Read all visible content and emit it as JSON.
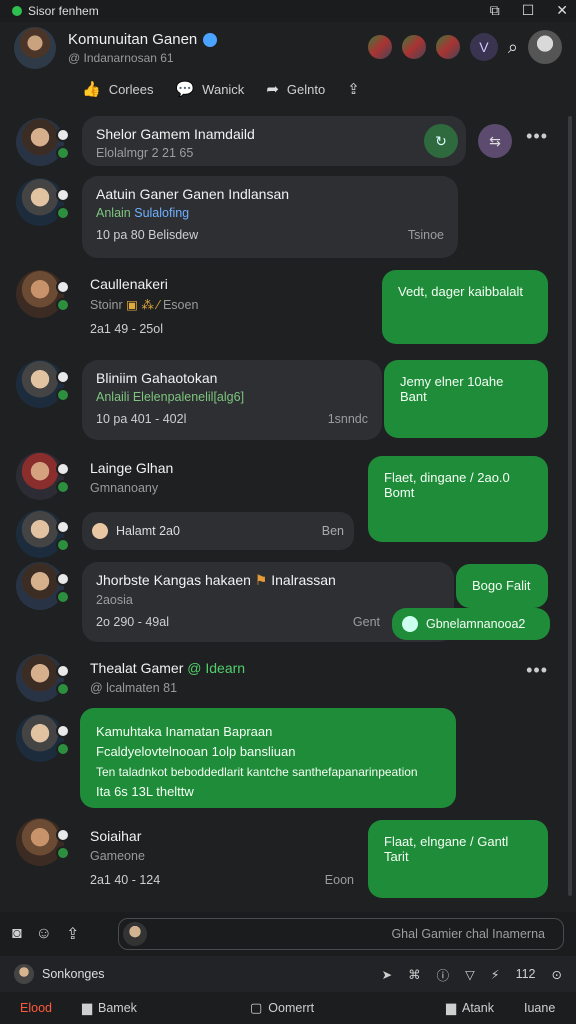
{
  "status": {
    "left_text": "Sisor fenhem",
    "win_icons": [
      "tabs-icon",
      "maximize-icon",
      "close-icon"
    ]
  },
  "header": {
    "title": "Komunuitan Ganen",
    "subtitle": "@ Indanarnosan 61",
    "v_badge": "V"
  },
  "actions": [
    {
      "label": "Corlees",
      "icon": "thumbs-up-icon"
    },
    {
      "label": "Wanick",
      "icon": "comment-icon"
    },
    {
      "label": "Gelnto",
      "icon": "share-icon"
    },
    {
      "label": "",
      "icon": "save-icon"
    }
  ],
  "posts": {
    "p1": {
      "name": "Shelor Gamem Inamdaild",
      "sub": "Elolalmgr 2 21 65"
    },
    "p2": {
      "name": "Aatuin Ganer Ganen Indlansan",
      "tag": "Anlain",
      "tag2": "Sulalofing",
      "meta_left": "10 pa   80 Belisdew",
      "meta_right": "Tsinoe"
    },
    "p3": {
      "name": "Caullenakeri",
      "sub": "Stoinr",
      "sub2": "Esoen",
      "meta": "2a1   49 - 25ol",
      "green": "Vedt, dager kaibbalalt"
    },
    "p4": {
      "name": "Bliniim Gahaotokan",
      "tag": "Anlaili",
      "tag2": "Elelenpalenelil[alg6]",
      "meta_left": "10 pa   401 - 402l",
      "meta_right": "1snndc",
      "green": "Jemy elner 10ahe Bant"
    },
    "p5": {
      "name": "Lainge Glhan",
      "sub": "Gmnanoany",
      "green": "Flaet, dingane / 2ao.0 Bomt",
      "pill": "Halamt 2a0",
      "pill_right": "Ben"
    },
    "p6": {
      "name": "Jhorbste Kangas hakaen",
      "name2": "Inalrassan",
      "sub": "2aosia",
      "meta_left": "2o   290 - 49al",
      "meta_right": "Gent",
      "green": "Bogo Falit",
      "pill": "Gbnelamnanooa2"
    },
    "p7": {
      "name": "Thealat Gamer",
      "tag": "@ Idearn",
      "sub": "@ lcalmaten 81"
    },
    "p8": {
      "lines": [
        "Kamuhtaka Inamatan Bapraan",
        "Fcaldyelovtelnooan 1olp bansliuan",
        "Ten taladnkot beboddedlarit kantche santhefapanarinpeation",
        "Ita 6s  13L thelttw"
      ]
    },
    "p9": {
      "name": "Soiaihar",
      "sub": "Gameone",
      "meta": "2a1   40 - 124",
      "meta_right": "Eoon",
      "green": "Flaat, elngane / Gantl Tarit"
    }
  },
  "input": {
    "placeholder": "Ghal Gamier chal Inamerna"
  },
  "secondbar": {
    "label": "Sonkonges",
    "count": "112"
  },
  "tabs": [
    {
      "label": "Elood",
      "icon": "fire-icon",
      "active": true
    },
    {
      "label": "Bamek",
      "icon": "chat-icon",
      "active": false
    },
    {
      "label": "Oomerrt",
      "icon": "page-icon",
      "active": false
    },
    {
      "label": "Atank",
      "icon": "chat2-icon",
      "active": false
    },
    {
      "label": "Iuane",
      "icon": "",
      "active": false
    }
  ]
}
